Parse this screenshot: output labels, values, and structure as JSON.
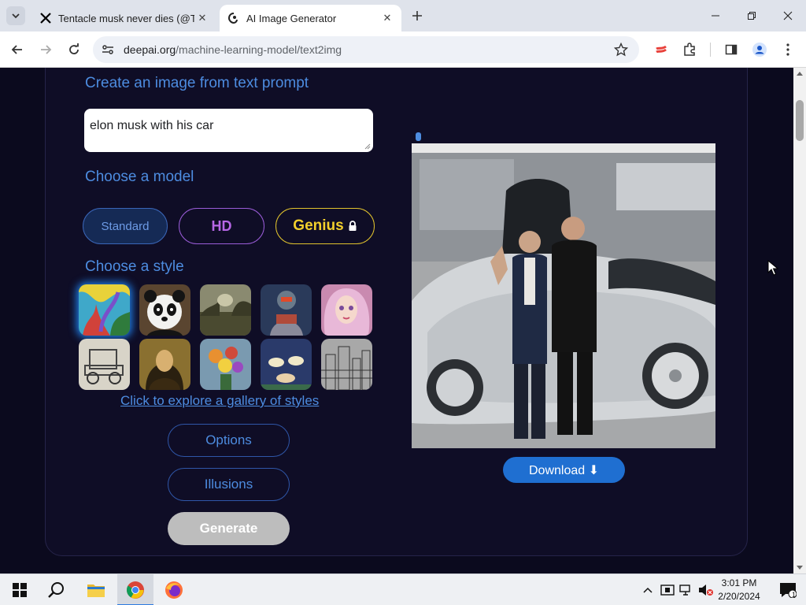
{
  "browser": {
    "tabs": [
      {
        "title": "Tentacle musk never dies (@Ter",
        "favicon": "x-logo-icon",
        "active": false
      },
      {
        "title": "AI Image Generator",
        "favicon": "deepai-logo-icon",
        "active": true
      }
    ],
    "url_host": "deepai.org",
    "url_path": "/machine-learning-model/text2img"
  },
  "page": {
    "prompt_heading": "Create an image from text prompt",
    "prompt_value": "elon musk with his car",
    "model_heading": "Choose a model",
    "models": [
      {
        "label": "Standard",
        "selected": true
      },
      {
        "label": "HD",
        "selected": false
      },
      {
        "label": "Genius",
        "selected": false,
        "locked": true
      }
    ],
    "style_heading": "Choose a style",
    "styles_selected_index": 0,
    "gallery_link": "Click to explore a gallery of styles",
    "options_label": "Options",
    "illusions_label": "Illusions",
    "generate_label": "Generate",
    "download_label": "Download ⬇"
  },
  "taskbar": {
    "time": "3:01 PM",
    "date": "2/20/2024",
    "notification_count": "1"
  },
  "colors": {
    "page_bg": "#0b0a1e",
    "accent_blue": "#4d8ce0",
    "download_btn": "#1f6fd1",
    "hd_purple": "#b767e6",
    "genius_yellow": "#f2cf2c"
  }
}
